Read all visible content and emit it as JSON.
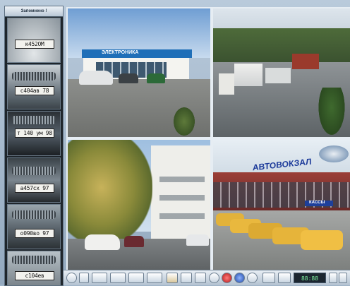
{
  "strip": {
    "header": "Запомнено !",
    "plates": [
      "к452ОМ",
      "с404ав 78",
      "т 140 ум 98",
      "а457сх 97",
      "о090во 97",
      "с104ев"
    ]
  },
  "cams": {
    "cam1": {
      "sign": "ЭЛЕКТРОНИКА"
    },
    "cam4": {
      "sign": "АВТОВОКЗАЛ",
      "sign2": "КАССЫ"
    }
  },
  "toolbar": {
    "counter": "88:88"
  }
}
